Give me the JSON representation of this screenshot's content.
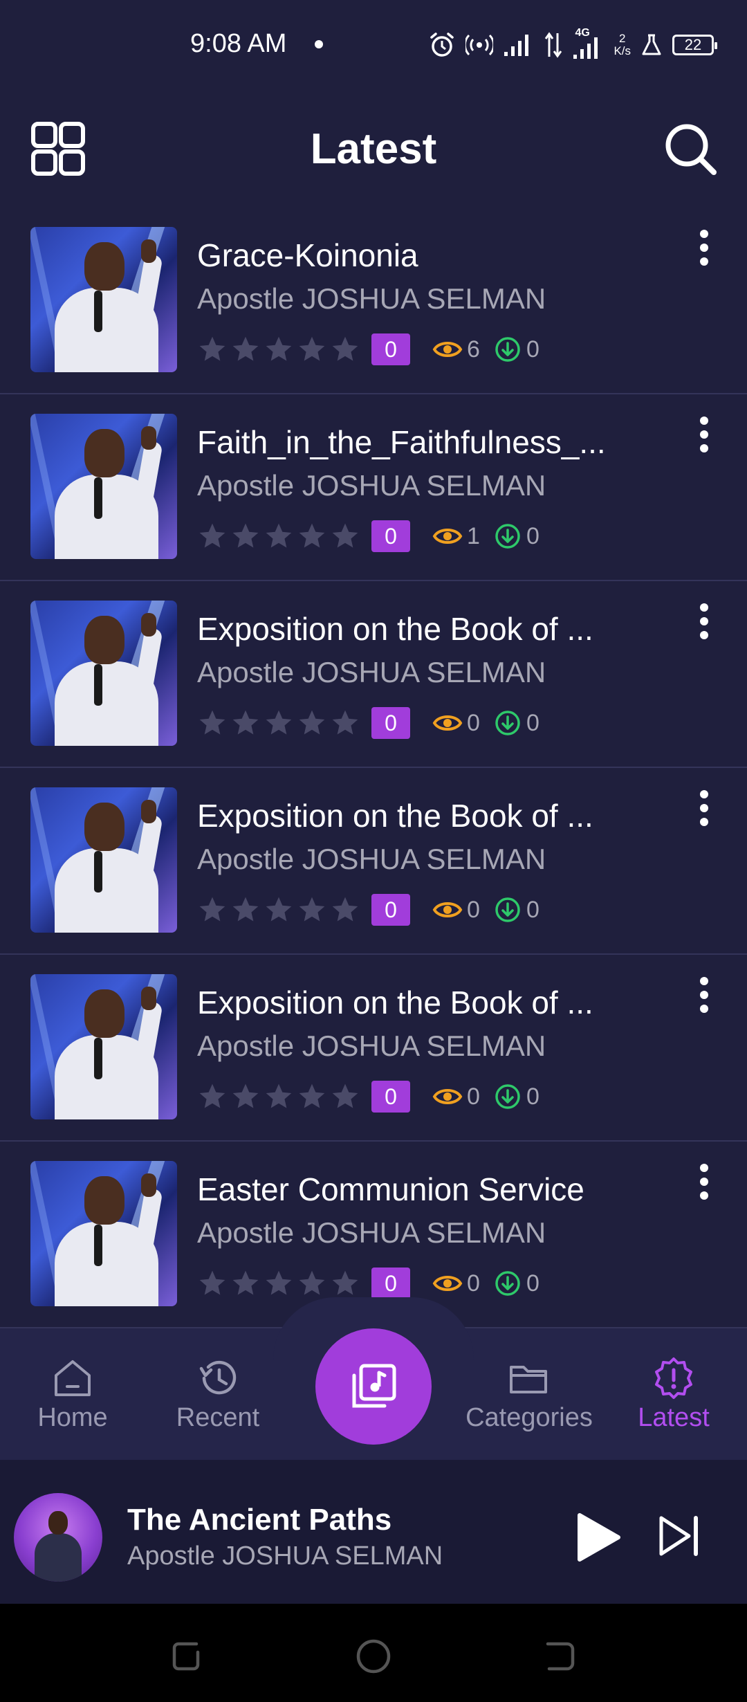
{
  "status_bar": {
    "time": "9:08 AM",
    "network_type": "4G",
    "net_speed_value": "2",
    "net_speed_unit": "K/s",
    "battery": "22"
  },
  "header": {
    "title": "Latest",
    "menu_icon": "grid-icon",
    "search_icon": "search-icon"
  },
  "sermons": [
    {
      "title": "Grace-Koinonia",
      "author": "Apostle JOSHUA SELMAN",
      "rating": "0",
      "views": "6",
      "downloads": "0"
    },
    {
      "title": "Faith_in_the_Faithfulness_...",
      "author": "Apostle JOSHUA SELMAN",
      "rating": "0",
      "views": "1",
      "downloads": "0"
    },
    {
      "title": "Exposition on the Book of ...",
      "author": "Apostle JOSHUA SELMAN",
      "rating": "0",
      "views": "0",
      "downloads": "0"
    },
    {
      "title": "Exposition on the Book of ...",
      "author": "Apostle JOSHUA SELMAN",
      "rating": "0",
      "views": "0",
      "downloads": "0"
    },
    {
      "title": "Exposition on the Book of ...",
      "author": "Apostle JOSHUA SELMAN",
      "rating": "0",
      "views": "0",
      "downloads": "0"
    },
    {
      "title": "Easter Communion Service",
      "author": "Apostle JOSHUA SELMAN",
      "rating": "0",
      "views": "0",
      "downloads": "0"
    }
  ],
  "bottom_nav": {
    "items": [
      {
        "label": "Home",
        "icon": "home-icon",
        "active": false
      },
      {
        "label": "Recent",
        "icon": "history-icon",
        "active": false
      },
      {
        "label": "Categories",
        "icon": "folder-icon",
        "active": false
      },
      {
        "label": "Latest",
        "icon": "badge-alert-icon",
        "active": true
      }
    ],
    "center_icon": "music-library-icon"
  },
  "mini_player": {
    "title": "The Ancient Paths",
    "author": "Apostle JOSHUA SELMAN"
  },
  "colors": {
    "background": "#1f1f3d",
    "accent": "#a13ddb",
    "views_icon": "#f0a020",
    "download_icon": "#2ec96a",
    "muted_text": "#a7a7b5"
  }
}
